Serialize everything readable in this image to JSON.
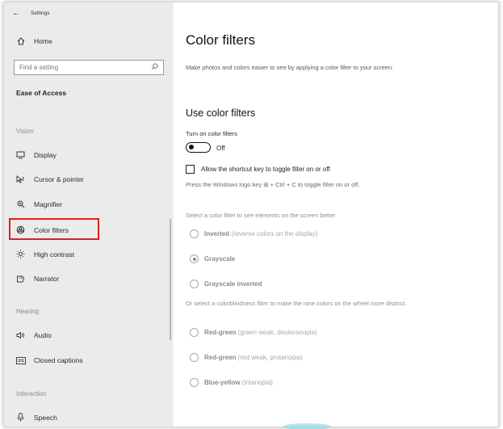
{
  "window": {
    "title": "Settings"
  },
  "sidebar": {
    "home_label": "Home",
    "search_placeholder": "Find a setting",
    "category": "Ease of Access",
    "sections": [
      {
        "label": "Vision",
        "items": [
          {
            "label": "Display",
            "icon": "monitor-icon"
          },
          {
            "label": "Cursor & pointer",
            "icon": "cursor-icon"
          },
          {
            "label": "Magnifier",
            "icon": "magnifier-icon"
          },
          {
            "label": "Color filters",
            "icon": "color-filters-icon",
            "selected": true
          },
          {
            "label": "High contrast",
            "icon": "sun-icon"
          },
          {
            "label": "Narrator",
            "icon": "narrator-icon"
          }
        ]
      },
      {
        "label": "Hearing",
        "items": [
          {
            "label": "Audio",
            "icon": "speaker-icon"
          },
          {
            "label": "Closed captions",
            "icon": "captions-icon"
          }
        ]
      },
      {
        "label": "Interaction",
        "items": [
          {
            "label": "Speech",
            "icon": "microphone-icon"
          }
        ]
      }
    ]
  },
  "main": {
    "title": "Color filters",
    "description": "Make photos and colors easier to see by applying a color filter to your screen.",
    "section_title": "Use color filters",
    "toggle_label": "Turn on color filters",
    "toggle_state": "Off",
    "shortcut_checkbox_label": "Allow the shortcut key to toggle filter on or off",
    "shortcut_hint": "Press the Windows logo key ⊞ + Ctrl + C to toggle filter on or off.",
    "select_label": "Select a color filter to see elements on the screen better",
    "filters": [
      {
        "name": "Inverted",
        "desc": "(reverse colors on the display)",
        "checked": false
      },
      {
        "name": "Grayscale",
        "desc": "",
        "checked": true
      },
      {
        "name": "Grayscale inverted",
        "desc": "",
        "checked": false
      }
    ],
    "colorblind_label": "Or select a colorblindness filter to make the nine colors on the wheel more distinct.",
    "colorblind_filters": [
      {
        "name": "Red-green",
        "desc": "(green weak, deuteranopia)",
        "checked": false
      },
      {
        "name": "Red-green",
        "desc": "(red weak, protanopia)",
        "checked": false
      },
      {
        "name": "Blue-yellow",
        "desc": "(tritanopia)",
        "checked": false
      }
    ]
  },
  "colors": {
    "highlight": "#e21d1d",
    "sidebar_bg": "#ebebeb"
  }
}
